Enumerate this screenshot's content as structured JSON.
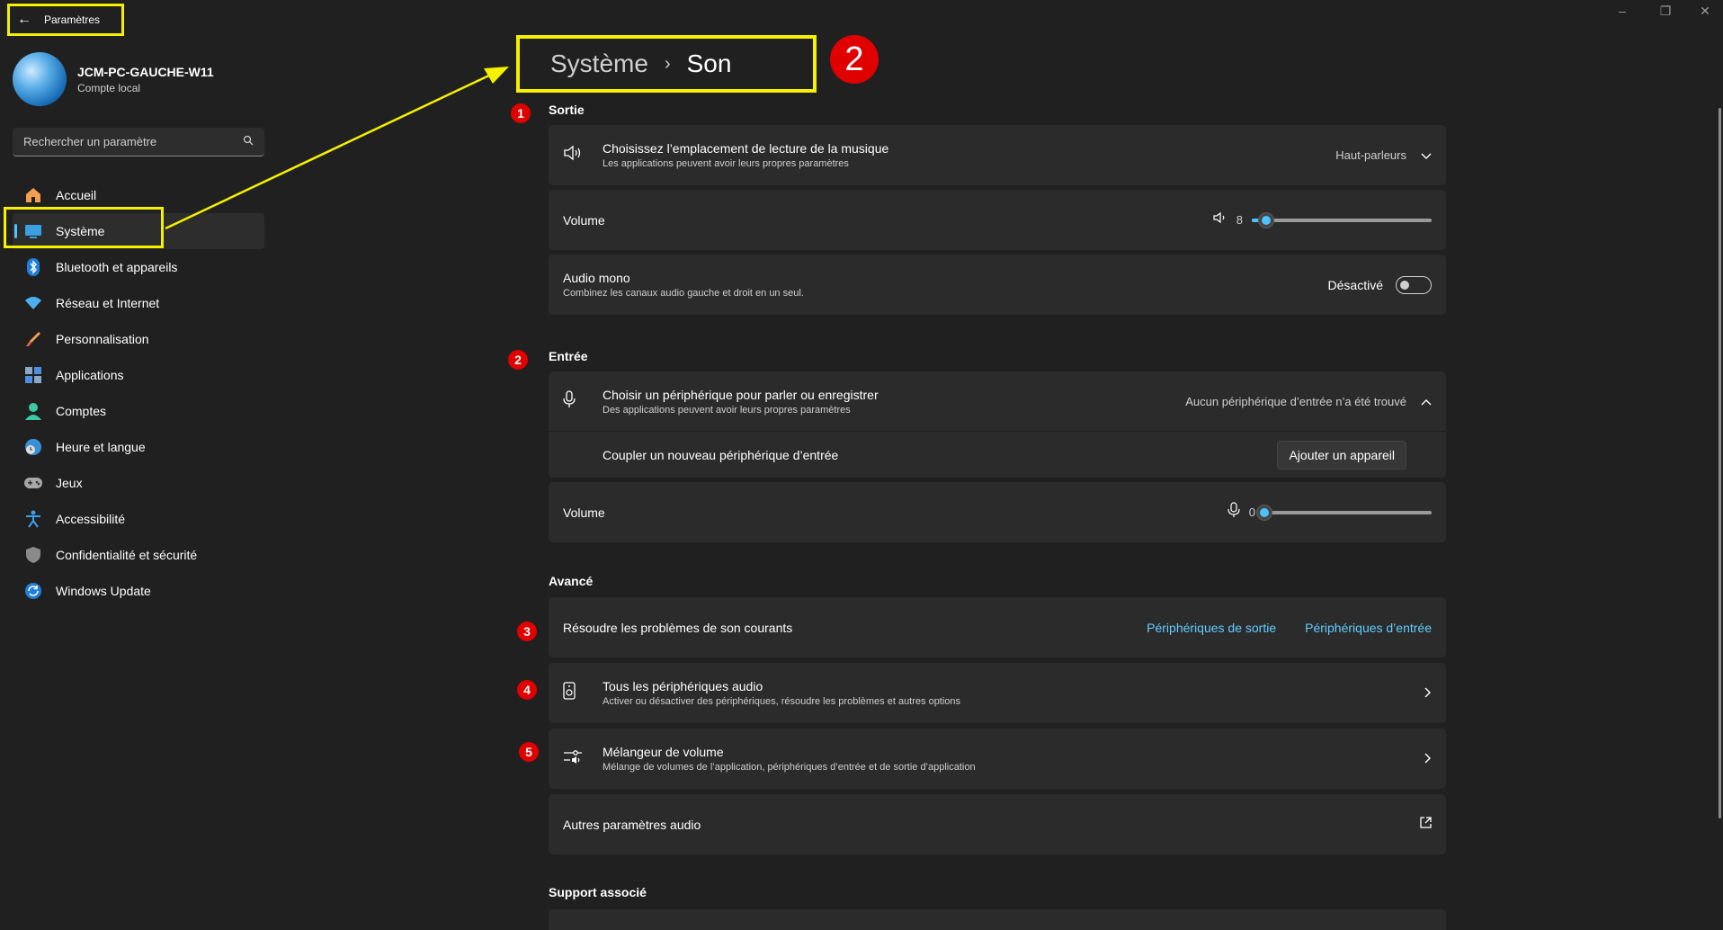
{
  "titlebar": {
    "back_label": "Paramètres"
  },
  "account": {
    "name": "JCM-PC-GAUCHE-W11",
    "type": "Compte local"
  },
  "search": {
    "placeholder": "Rechercher un paramètre"
  },
  "sidebar": {
    "items": [
      {
        "label": "Accueil",
        "icon": "home-icon"
      },
      {
        "label": "Système",
        "icon": "monitor-icon",
        "active": true
      },
      {
        "label": "Bluetooth et appareils",
        "icon": "bluetooth-icon"
      },
      {
        "label": "Réseau et Internet",
        "icon": "wifi-icon"
      },
      {
        "label": "Personnalisation",
        "icon": "brush-icon"
      },
      {
        "label": "Applications",
        "icon": "apps-icon"
      },
      {
        "label": "Comptes",
        "icon": "person-icon"
      },
      {
        "label": "Heure et langue",
        "icon": "globe-clock-icon"
      },
      {
        "label": "Jeux",
        "icon": "gamepad-icon"
      },
      {
        "label": "Accessibilité",
        "icon": "accessibility-icon"
      },
      {
        "label": "Confidentialité et sécurité",
        "icon": "shield-icon"
      },
      {
        "label": "Windows Update",
        "icon": "update-icon"
      }
    ]
  },
  "breadcrumb": {
    "parent": "Système",
    "separator": "›",
    "current": "Son",
    "badge": "2"
  },
  "output": {
    "title": "Sortie",
    "badge": "1",
    "location": {
      "title": "Choisissez l’emplacement de lecture de la musique",
      "subtitle": "Les applications peuvent avoir leurs propres paramètres",
      "value": "Haut-parleurs"
    },
    "volume": {
      "label": "Volume",
      "value": "8",
      "fraction": 0.08
    },
    "mono": {
      "title": "Audio mono",
      "subtitle": "Combinez les canaux audio gauche et droit en un seul.",
      "state": "Désactivé"
    }
  },
  "input": {
    "title": "Entrée",
    "badge": "2",
    "device": {
      "title": "Choisir un périphérique pour parler ou enregistrer",
      "subtitle": "Des applications peuvent avoir leurs propres paramètres",
      "value": "Aucun périphérique d’entrée n’a été trouvé"
    },
    "pair": {
      "label": "Coupler un nouveau périphérique d’entrée",
      "button": "Ajouter un appareil"
    },
    "volume": {
      "label": "Volume",
      "value": "0",
      "fraction": 0
    }
  },
  "advanced": {
    "title": "Avancé",
    "troubleshoot": {
      "badge": "3",
      "label": "Résoudre les problèmes de son courants",
      "link_output": "Périphériques de sortie",
      "link_input": "Périphériques d’entrée"
    },
    "all_devices": {
      "badge": "4",
      "title": "Tous les périphériques audio",
      "subtitle": "Activer ou désactiver des périphériques, résoudre les problèmes et autres options"
    },
    "mixer": {
      "badge": "5",
      "title": "Mélangeur de volume",
      "subtitle": "Mélange de volumes de l’application, périphériques d’entrée et de sortie d’application"
    },
    "more": {
      "label": "Autres paramètres audio"
    }
  },
  "support": {
    "title": "Support associé"
  },
  "colors": {
    "highlight": "#f5f000",
    "badge": "#e00000",
    "accent": "#4cc2ff",
    "link": "#60cdff",
    "background": "#202020",
    "card": "#2b2b2b"
  }
}
